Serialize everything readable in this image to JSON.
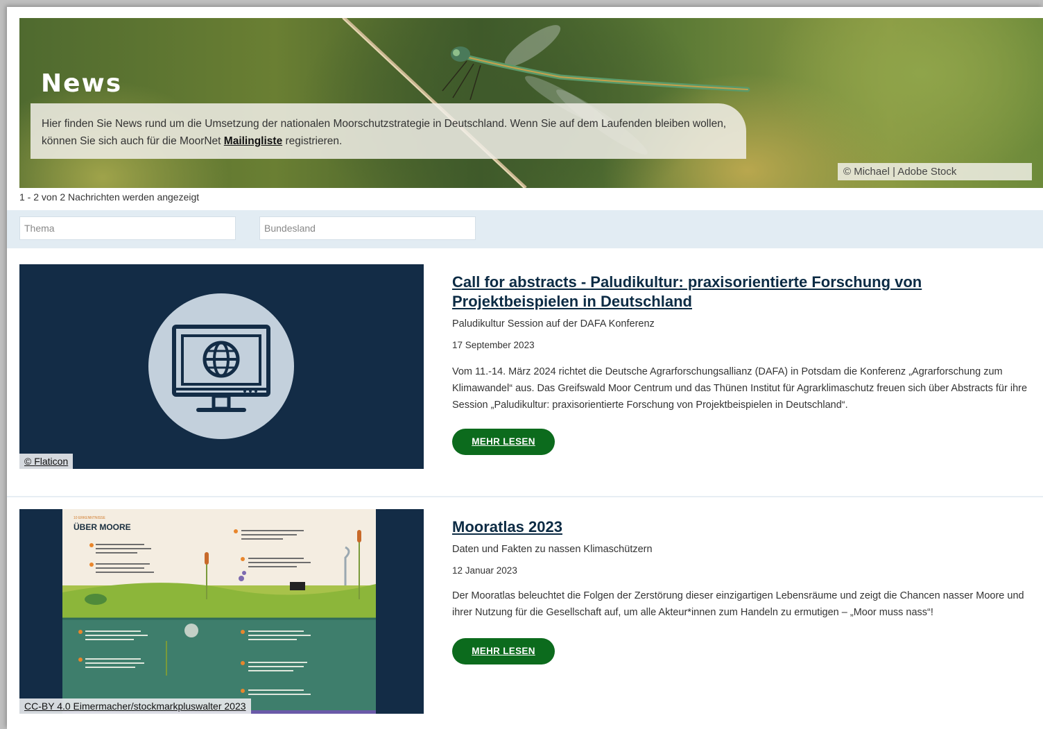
{
  "hero": {
    "title": "News",
    "intro_before": "Hier finden Sie News rund um die Umsetzung der nationalen Moorschutzstrategie in Deutschland. Wenn Sie auf dem Laufenden bleiben wollen, können Sie sich auch für die MoorNet ",
    "intro_link": "Mailingliste",
    "intro_after": " registrieren.",
    "image_credit": "© Michael | Adobe Stock"
  },
  "results": {
    "count_text": "1 - 2 von 2 Nachrichten werden angezeigt"
  },
  "filters": {
    "topic_placeholder": "Thema",
    "state_placeholder": "Bundesland"
  },
  "news": [
    {
      "title": "Call for abstracts - Paludikultur: praxisorientierte Forschung von Projektbeispielen in Deutschland",
      "subtitle": "Paludikultur Session auf der DAFA Konferenz",
      "date": "17 September 2023",
      "body": "Vom 11.-14. März 2024 richtet die Deutsche Agrarforschungsallianz (DAFA) in Potsdam die Konferenz „Agrarforschung zum Klimawandel“ aus. Das Greifswald Moor Centrum und das Thünen Institut für Agrarklimaschutz freuen sich über Abstracts für ihre Session „Paludikultur: praxisorientierte Forschung von Projektbeispielen in Deutschland“.",
      "button": "MEHR LESEN",
      "image_credit": "© Flaticon",
      "image_icon": "monitor-globe-icon"
    },
    {
      "title": "Mooratlas 2023",
      "subtitle": "Daten und Fakten zu nassen Klimaschützern",
      "date": "12 Januar 2023",
      "body": "Der Mooratlas beleuchtet die Folgen der Zerstörung dieser einzigartigen Lebensräume und zeigt die Chancen nasser Moore und ihrer Nutzung für die Gesellschaft auf, um alle Akteur*innen zum Handeln zu ermutigen – „Moor muss nass“!",
      "button": "MEHR LESEN",
      "image_credit": "CC-BY 4.0 Eimermacher/stockmarkpluswalter 2023",
      "image_heading_small": "10 ERKENNTNISSE",
      "image_heading": "ÜBER MOORE"
    }
  ],
  "colors": {
    "button_green": "#0c6b1d",
    "title_navy": "#0c2b44",
    "filter_bar": "#e2ecf3",
    "thumb_bg": "#132c46"
  }
}
